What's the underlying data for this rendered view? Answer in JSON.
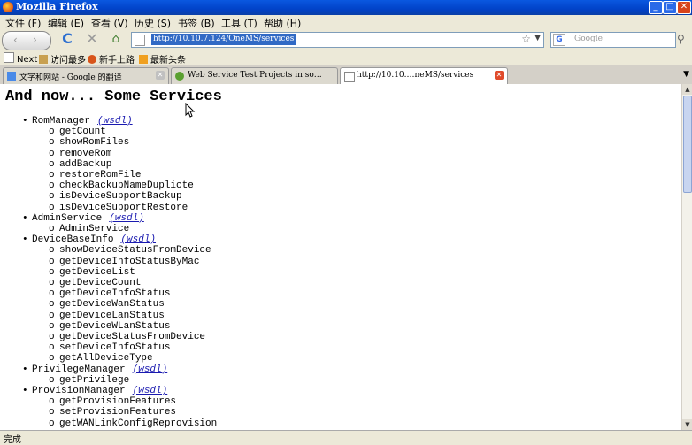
{
  "window": {
    "title": "Mozilla Firefox",
    "min": "_",
    "max": "□",
    "close": "✕"
  },
  "menu": [
    "文件 (F)",
    "编辑 (E)",
    "查看 (V)",
    "历史 (S)",
    "书签 (B)",
    "工具 (T)",
    "帮助 (H)"
  ],
  "nav": {
    "url": "http://10.10.7.124/OneMS/services",
    "search_placeholder": "Google",
    "back_label": "‹",
    "forward_label": "›",
    "reload_label": "C",
    "stop_label": "✕",
    "home_label": "⌂"
  },
  "bookmarks": [
    "Next",
    "访问最多",
    "新手上路",
    "最新头条"
  ],
  "tabs": [
    {
      "label": "文字和网站 - Google 的翻译",
      "active": false
    },
    {
      "label": "Web Service Test Projects in so…",
      "active": false
    },
    {
      "label": "http://10.10.…neMS/services",
      "active": true
    }
  ],
  "page": {
    "heading": "And now... Some Services",
    "wsdl_label": "(wsdl)",
    "services": [
      {
        "name": "RomManager",
        "operations": [
          "getCount",
          "showRomFiles",
          "removeRom",
          "addBackup",
          "restoreRomFile",
          "checkBackupNameDuplicte",
          "isDeviceSupportBackup",
          "isDeviceSupportRestore"
        ]
      },
      {
        "name": "AdminService",
        "operations": [
          "AdminService"
        ]
      },
      {
        "name": "DeviceBaseInfo",
        "operations": [
          "showDeviceStatusFromDevice",
          "getDeviceInfoStatusByMac",
          "getDeviceList",
          "getDeviceCount",
          "getDeviceInfoStatus",
          "getDeviceWanStatus",
          "getDeviceLanStatus",
          "getDeviceWLanStatus",
          "getDeviceStatusFromDevice",
          "setDeviceInfoStatus",
          "getAllDeviceType"
        ]
      },
      {
        "name": "PrivilegeManager",
        "operations": [
          "getPrivilege"
        ]
      },
      {
        "name": "ProvisionManager",
        "operations": [
          "getProvisionFeatures",
          "setProvisionFeatures",
          "getWANLinkConfigReprovision"
        ]
      }
    ]
  },
  "status": "完成"
}
